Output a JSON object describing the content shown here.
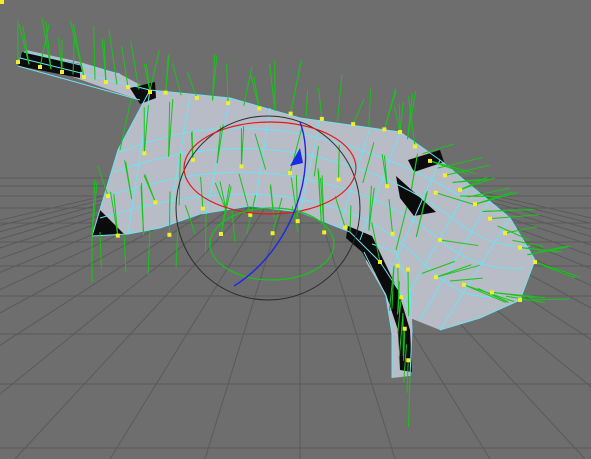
{
  "viewport": {
    "kind": "3d-perspective-viewport",
    "background_color": "#6e6e6e",
    "grid_color": "#5a5a5a",
    "mesh_fill_color": "#b7bcc6",
    "mesh_dark_color": "#0b0b0b",
    "mesh_edge_color": "#6fe3f2",
    "normal_color": "#19c41a",
    "vertex_color": "#f2ef2a",
    "rotate_gizmo": {
      "x_axis_color": "#e01a1a",
      "y_axis_color": "#19c41a",
      "z_axis_color": "#1a2ae6",
      "outline_color": "#2b2b2b"
    },
    "selection_mode": "vertices",
    "display_normals": true
  }
}
